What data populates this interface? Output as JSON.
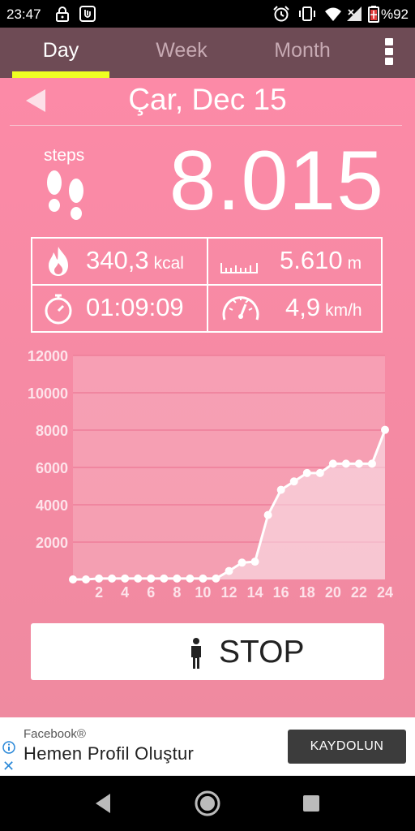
{
  "status_bar": {
    "time": "23:47",
    "battery": "%92",
    "icons": [
      "lock-icon",
      "app-notification-icon",
      "alarm-icon",
      "vibrate-icon",
      "wifi-icon",
      "signal-icon",
      "battery-icon"
    ]
  },
  "tabs": [
    {
      "label": "Day",
      "active": true
    },
    {
      "label": "Week",
      "active": false
    },
    {
      "label": "Month",
      "active": false
    }
  ],
  "date": "Çar, Dec 15",
  "steps": {
    "label": "steps",
    "value": "8.015"
  },
  "stats": {
    "calories": {
      "value": "340,3",
      "unit": "kcal"
    },
    "distance": {
      "value": "5.610",
      "unit": "m"
    },
    "duration": {
      "value": "01:09:09"
    },
    "speed": {
      "value": "4,9",
      "unit": "km/h"
    }
  },
  "chart_data": {
    "type": "area",
    "x": [
      0,
      1,
      2,
      3,
      4,
      5,
      6,
      7,
      8,
      9,
      10,
      11,
      12,
      13,
      14,
      15,
      16,
      17,
      18,
      19,
      20,
      21,
      22,
      23,
      24
    ],
    "values": [
      0,
      0,
      50,
      50,
      50,
      50,
      50,
      50,
      50,
      50,
      50,
      50,
      450,
      900,
      950,
      3450,
      4800,
      5250,
      5700,
      5700,
      6200,
      6200,
      6200,
      6200,
      8015
    ],
    "x_ticks": [
      2,
      4,
      6,
      8,
      10,
      12,
      14,
      16,
      18,
      20,
      22,
      24
    ],
    "y_ticks": [
      2000,
      4000,
      6000,
      8000,
      10000,
      12000
    ],
    "ylim": [
      0,
      12000
    ],
    "xlim": [
      0,
      24
    ],
    "grid": true,
    "colors": {
      "line": "#ffffff",
      "fill": "#f9e6ec",
      "grid": "#ee7f99"
    }
  },
  "stop_button": {
    "label": "STOP"
  },
  "ad": {
    "brand": "Facebook®",
    "title": "Hemen Profil Oluştur",
    "cta": "KAYDOLUN",
    "close": "✕"
  },
  "colors": {
    "tabbar": "#6e4b55",
    "tab_indicator": "#eeff22",
    "background": "#fc8aa7",
    "accent_ad": "#2a88d8"
  }
}
